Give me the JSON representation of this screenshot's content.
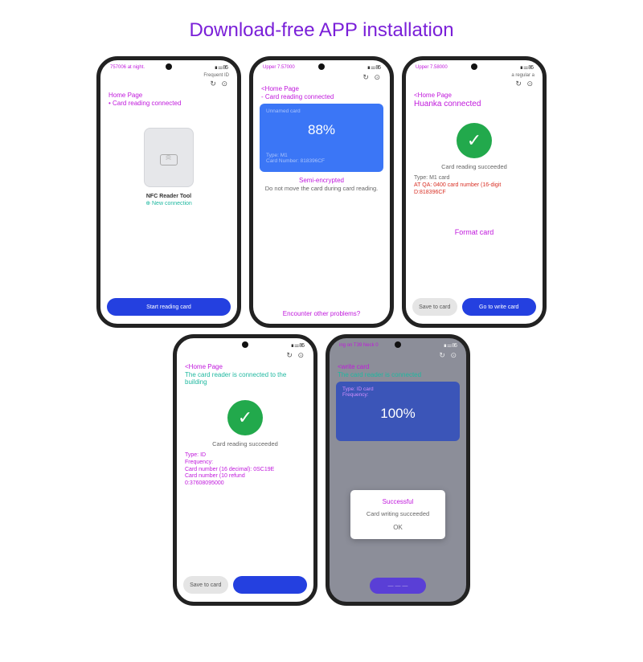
{
  "title": "Download-free APP installation",
  "phones": [
    {
      "status_left": "757006 at night.",
      "status_right": "∎ ⚌ 86‎",
      "hdr_left": "",
      "hdr_right": "Frequent ID",
      "home": "Home Page",
      "line1": "Card reading connected",
      "tool": "NFC Reader Tool",
      "new_conn": "⊕ New connection",
      "btn_primary": "Start reading card"
    },
    {
      "status_left": "Upper 7.57000",
      "status_right": "∎ ⚌ 86‎",
      "home": "<Home Page",
      "line1": "- Card reading connected",
      "card_title": "Unnamed card",
      "pct": "88%",
      "type": "Type: M1",
      "cn": "Card Number: 818396CF",
      "warn1": "Semi-encrypted",
      "warn2": "Do not move the card during card reading.",
      "footer_link": "Encounter other problems?"
    },
    {
      "status_left": "Upper 7.58000",
      "status_right": "∎ ⚌ 86‎",
      "hdr_right": "a regular a",
      "home": "<Home Page",
      "line1": "Huanka connected",
      "succ": "Card reading succeeded",
      "type": "Type: M1 card",
      "cn1": "AT QA: 0400 card number (16-digit",
      "cn2": "D:818396CF",
      "format": "Format card",
      "btn_secondary": "Save to card",
      "btn_primary": "Go to write card"
    },
    {
      "status_left": "",
      "status_right": "∎ ⚌ 86‎",
      "home": "<Home Page",
      "line1": "The card reader is connected to the building",
      "succ": "Card reading succeeded",
      "info": "Type: ID\nFrequency:\nCard number (16 decimal): 0SC19E\nCard number (10 refund\n0:37608095000",
      "btn_secondary": "Save to card",
      "btn_primary": ""
    },
    {
      "status_left": "ing on T39 Neck 0",
      "status_right": "∎ ⚌ 86‎",
      "home": "<write card",
      "line1": "The card reader is connected",
      "type": "Type: ID card",
      "freq": "Frequency:",
      "pct": "100%",
      "popup1": "Successful",
      "popup2": "Card writing succeeded",
      "ok": "OK",
      "ov_btn": "— — —"
    }
  ],
  "icons": {
    "header_right": "↻  ⊙"
  }
}
